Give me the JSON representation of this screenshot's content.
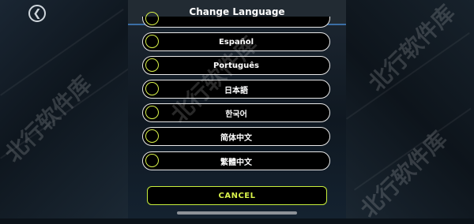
{
  "dialog": {
    "title": "Change Language",
    "options": [
      {
        "label": "Español"
      },
      {
        "label": "Português"
      },
      {
        "label": "日本語"
      },
      {
        "label": "한국어"
      },
      {
        "label": "简体中文"
      },
      {
        "label": "繁體中文"
      }
    ],
    "cancel_label": "CANCEL"
  },
  "nav": {
    "back_icon": "chevron-left-icon"
  },
  "watermark": "北行软件库",
  "colors": {
    "accent": "#d9f24a",
    "header_line": "#3b6ea5",
    "option_border": "#e8e8e8",
    "background": "#0b1219"
  }
}
